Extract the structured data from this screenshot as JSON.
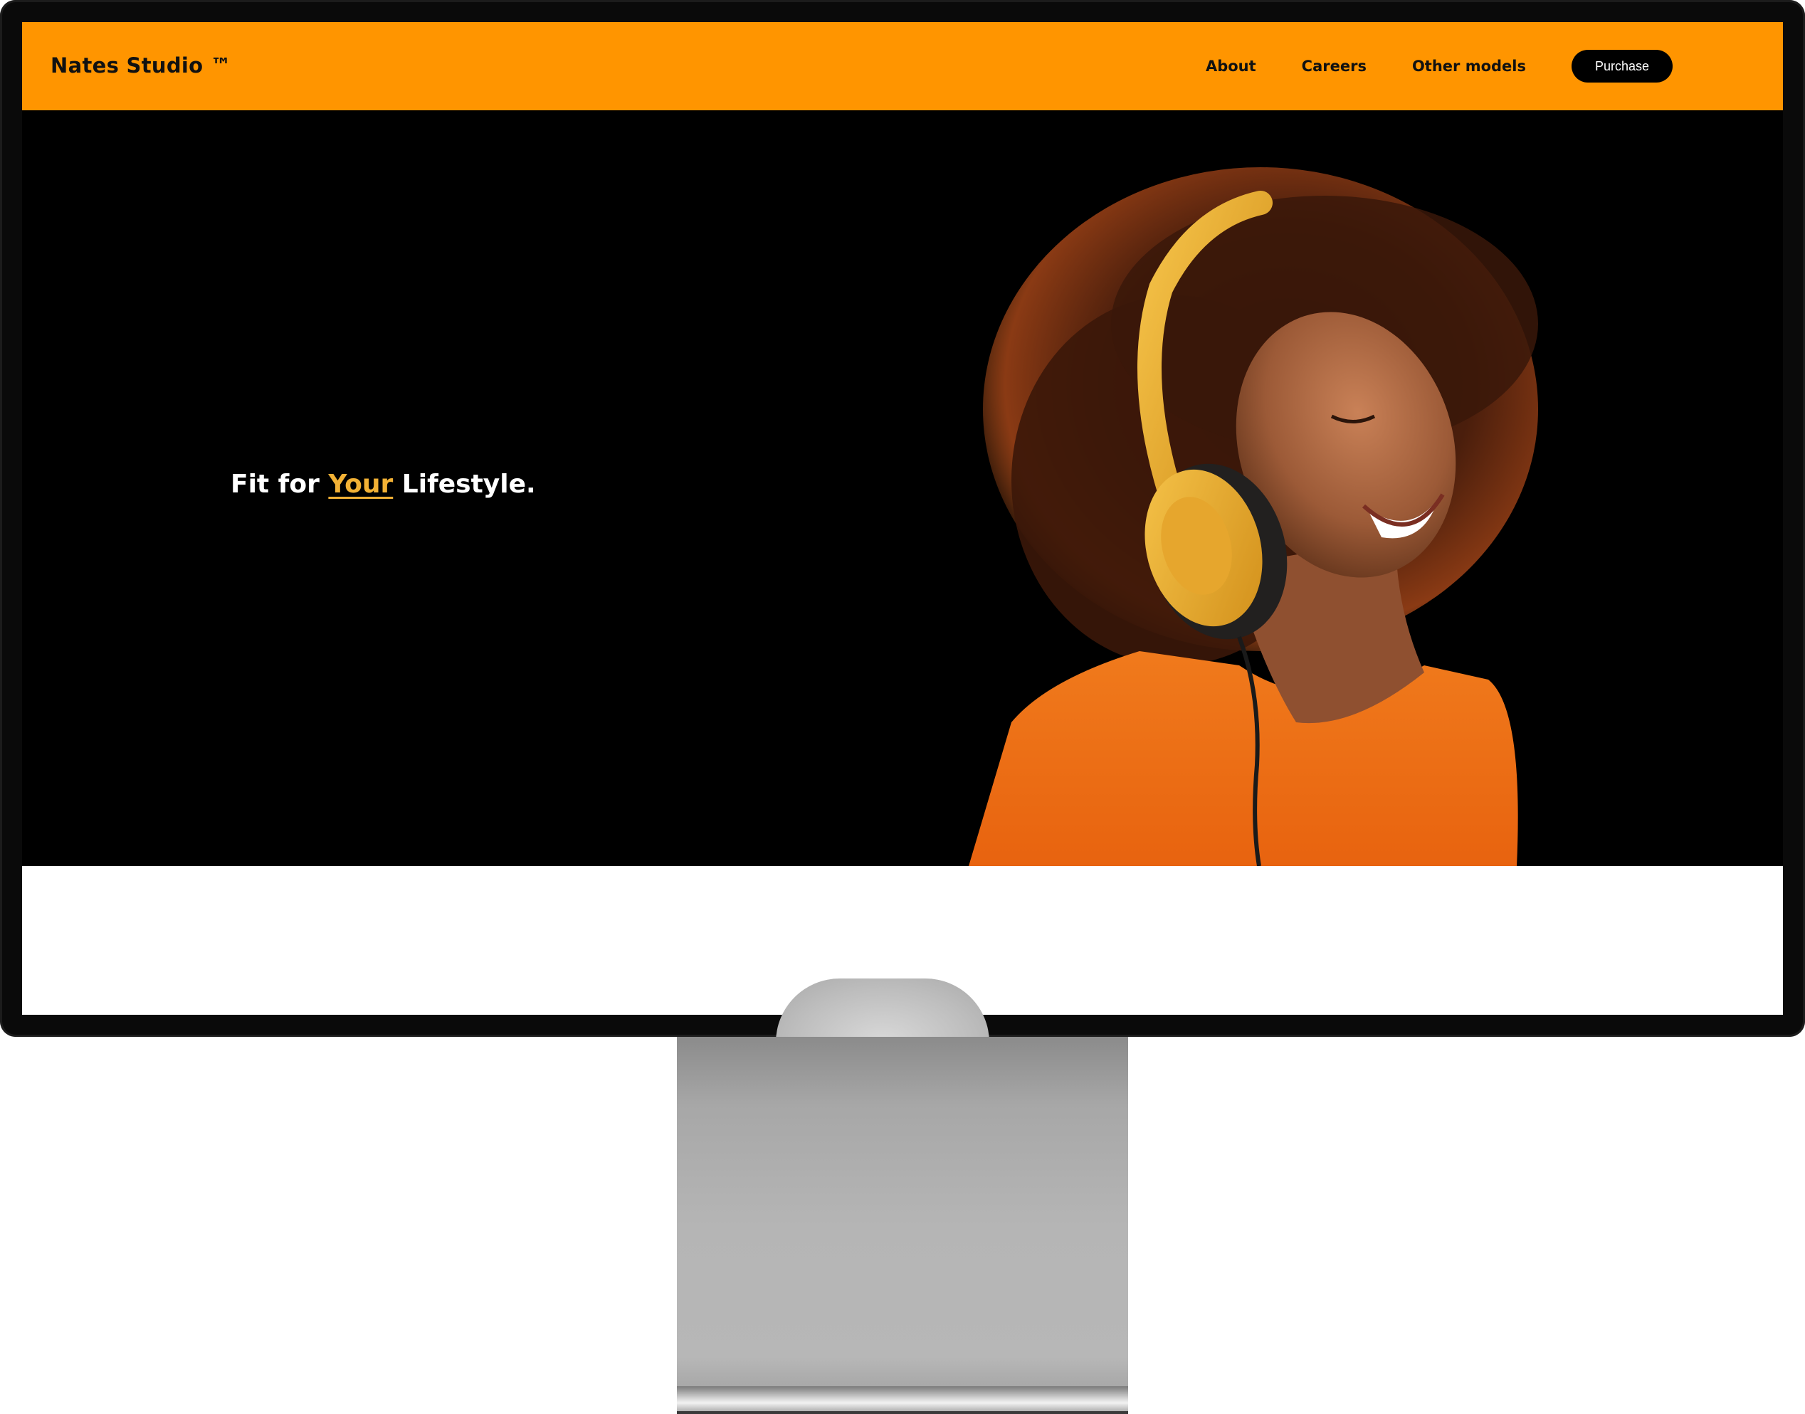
{
  "site": {
    "logo": "Nates Studio ™",
    "nav": {
      "about": "About",
      "careers": "Careers",
      "other_models": "Other models",
      "purchase": "Purchase"
    },
    "hero": {
      "tagline_pre": "Fit for ",
      "tagline_accent": "Your",
      "tagline_post": " Lifestyle.",
      "image_alt": "Smiling woman wearing yellow headphones"
    }
  },
  "colors": {
    "header": "#ff9500",
    "hero_bg": "#000000",
    "accent": "#f2b135"
  },
  "icons": {
    "hero_image": "person-with-headphones-illustration"
  }
}
